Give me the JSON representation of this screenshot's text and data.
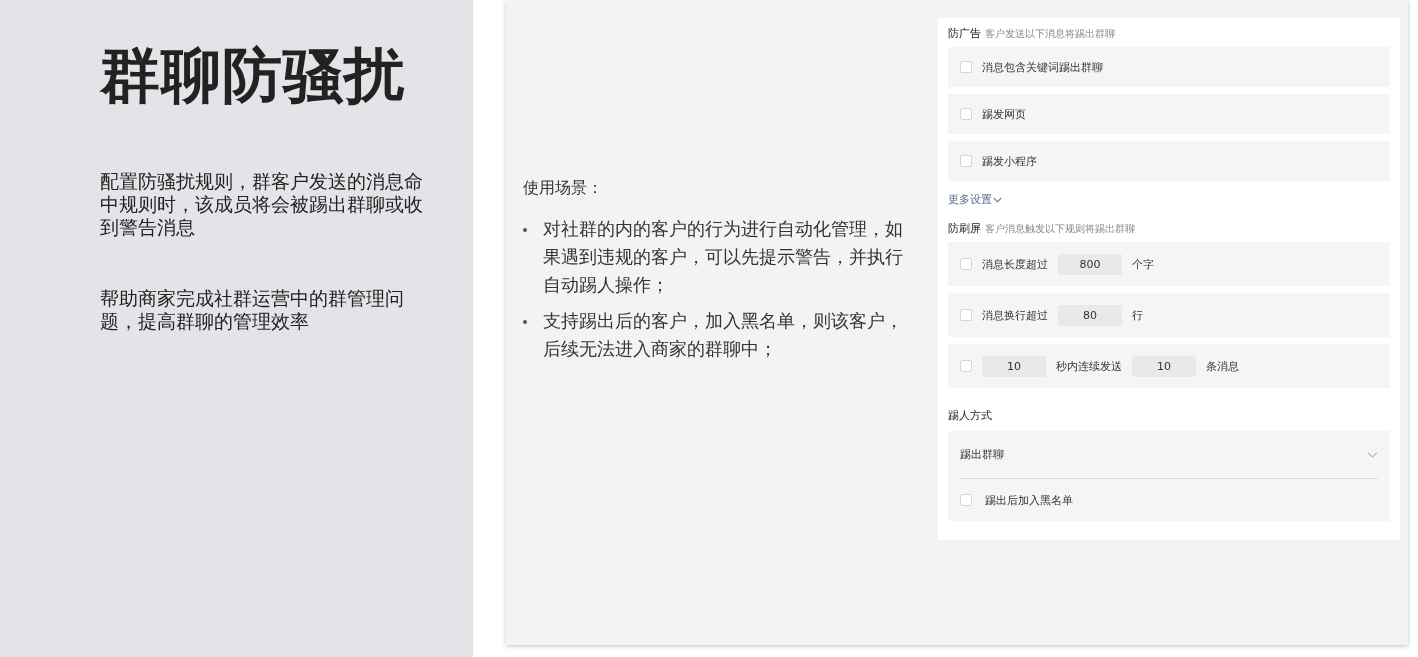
{
  "hero": {
    "title": "群聊防骚扰",
    "paragraphs": [
      "配置防骚扰规则，群客户发送的消息命中规则时，该成员将会被踢出群聊或收到警告消息",
      "帮助商家完成社群运营中的群管理问题，提高群聊的管理效率"
    ]
  },
  "usage": {
    "heading": "使用场景：",
    "bullets": [
      "对社群的内的客户的行为进行自动化管理，如果遇到违规的客户，可以先提示警告，并执行自动踢人操作；",
      "支持踢出后的客户，加入黑名单，则该客户，后续无法进入商家的群聊中；"
    ]
  },
  "anti_ads": {
    "title": "防广告",
    "hint": "客户发送以下消息将踢出群聊",
    "rows": [
      {
        "kind": "plain",
        "checked": false,
        "label": "消息包含关键词踢出群聊"
      },
      {
        "kind": "plain",
        "checked": false,
        "label": "踢发网页"
      },
      {
        "kind": "plain",
        "checked": false,
        "label": "踢发小程序"
      }
    ],
    "more": "更多设置"
  },
  "anti_spam": {
    "title": "防刷屏",
    "hint": "客户消息触发以下规则将踢出群聊",
    "rows": [
      {
        "kind": "limit",
        "checked": false,
        "label": "消息长度超过",
        "value": "800",
        "unit": "个字"
      },
      {
        "kind": "limit",
        "checked": false,
        "label": "消息换行超过",
        "value": "80",
        "unit": "行"
      },
      {
        "kind": "rate",
        "checked": false,
        "value": "10",
        "label": "秒内连续发送",
        "value2": "10",
        "unit": "条消息"
      }
    ]
  },
  "kick": {
    "title": "踢人方式",
    "select": "踢出群聊",
    "blacklist": {
      "checked": false,
      "label": "踢出后加入黑名单"
    }
  }
}
